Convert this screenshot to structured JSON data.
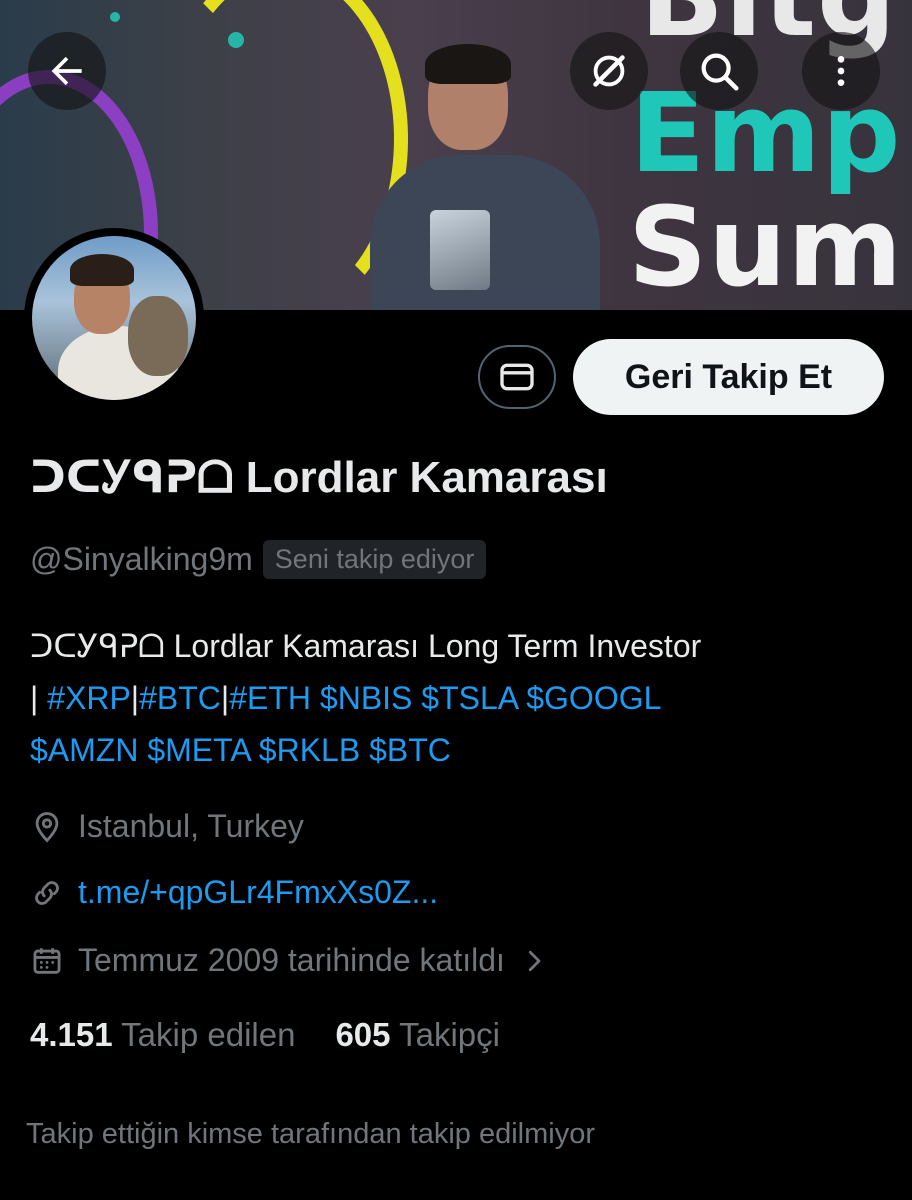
{
  "banner": {
    "text_lines": [
      "Bitg",
      "Emp",
      "Sum"
    ]
  },
  "profile": {
    "display_name": "ᑐᑕᎩᑫᕈᗝ Lordlar Kamarası",
    "handle": "@Sinyalking9m",
    "follows_you_badge": "Seni takip ediyor",
    "bio": {
      "line1": "ᑐᑕᎩᑫᕈᗝ Lordlar Kamarası Long Term Investor",
      "line2_sep1": "| ",
      "tag_xrp": "#XRP",
      "line2_sep2": "|",
      "tag_btc": "#BTC",
      "line2_sep3": "|",
      "tag_eth": "#ETH",
      "cashtag_nbis": "$NBIS",
      "cashtag_tsla": "$TSLA",
      "cashtag_googl": "$GOOGL",
      "cashtag_amzn": "$AMZN",
      "cashtag_meta": "$META",
      "cashtag_rklb": "$RKLB",
      "cashtag_btc": "$BTC"
    },
    "location": "Istanbul, Turkey",
    "website": "t.me/+qpGLr4FmxXs0Z...",
    "joined": "Temmuz 2009 tarihinde katıldı",
    "following_count": "4.151",
    "following_label": "Takip edilen",
    "followers_count": "605",
    "followers_label": "Takipçi",
    "followers_you_know_note": "Takip ettiğin kimse tarafından takip edilmiyor"
  },
  "actions": {
    "follow_back_label": "Geri Takip Et"
  },
  "icons": {
    "back": "back-arrow-icon",
    "grok": "grok-icon",
    "search": "search-icon",
    "more": "more-vertical-icon",
    "message": "envelope-icon",
    "location": "location-pin-icon",
    "link": "link-icon",
    "calendar": "calendar-icon",
    "chevron": "chevron-right-icon"
  },
  "colors": {
    "accent": "#1d9bf0",
    "background": "#000000",
    "secondary_text": "#71767b",
    "primary_text": "#e7e9ea"
  }
}
